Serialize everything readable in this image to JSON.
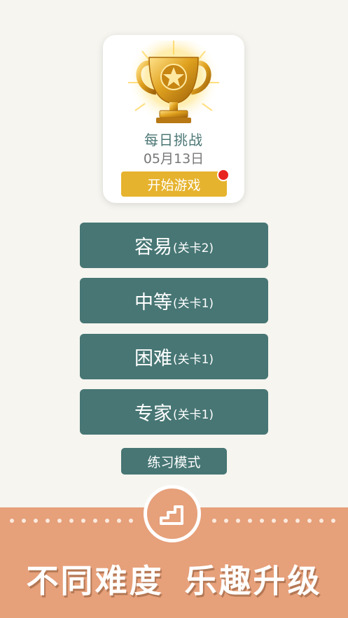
{
  "daily": {
    "title": "每日挑战",
    "date": "05月13日",
    "start_label": "开始游戏"
  },
  "levels": [
    {
      "name": "容易",
      "detail": "(关卡2)"
    },
    {
      "name": "中等",
      "detail": "(关卡1)"
    },
    {
      "name": "困难",
      "detail": "(关卡1)"
    },
    {
      "name": "专家",
      "detail": "(关卡1)"
    }
  ],
  "practice_label": "练习模式",
  "banner": {
    "slogan_left": "不同难度",
    "slogan_right": "乐趣升级",
    "icon": "stairs-icon"
  },
  "colors": {
    "background": "#f6f5f0",
    "level_button": "#477674",
    "start_button": "#e6b32e",
    "banner": "#e6a07a",
    "badge": "#e8241f"
  }
}
